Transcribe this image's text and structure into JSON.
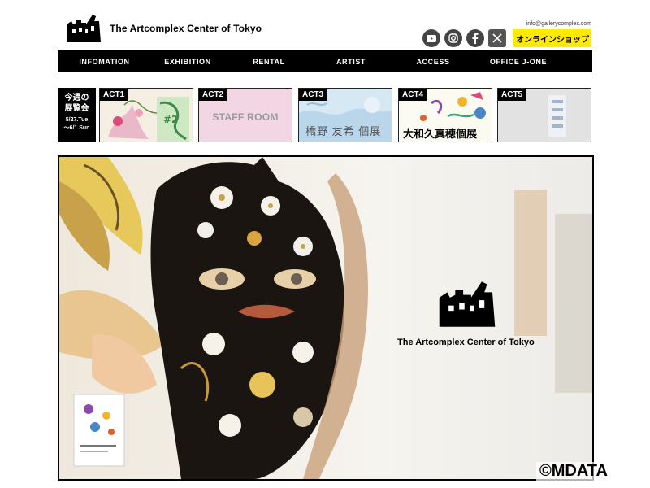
{
  "header": {
    "site_title": "The Artcomplex Center of Tokyo",
    "email": "info@gallerycomplex.com",
    "shop_label": "オンラインショップ",
    "social_icons": [
      "youtube-icon",
      "instagram-icon",
      "facebook-icon",
      "x-icon"
    ]
  },
  "nav": {
    "items": [
      "INFOMATION",
      "EXHIBITION",
      "RENTAL",
      "ARTIST",
      "ACCESS",
      "OFFICE J-ONE"
    ]
  },
  "week": {
    "title_line1": "今週の",
    "title_line2": "展覧会",
    "date_start": "5/27.Tue",
    "date_end": "〜6/1.Sun"
  },
  "acts": [
    {
      "tag": "ACT1",
      "caption": ""
    },
    {
      "tag": "ACT2",
      "caption": "STAFF ROOM"
    },
    {
      "tag": "ACT3",
      "caption": "橋野 友希 個展"
    },
    {
      "tag": "ACT4",
      "caption": "大和久真穂個展"
    },
    {
      "tag": "ACT5",
      "caption": ""
    }
  ],
  "hero": {
    "title": "The Artcomplex Center of Tokyo"
  },
  "watermark": "©MDATA",
  "colors": {
    "accent_yellow": "#ffea00",
    "nav_bg": "#000000",
    "staff_room_bg": "#f3d6e3",
    "act3_bg": "#cfe3f0",
    "act5_bg": "#e0e0e0"
  }
}
